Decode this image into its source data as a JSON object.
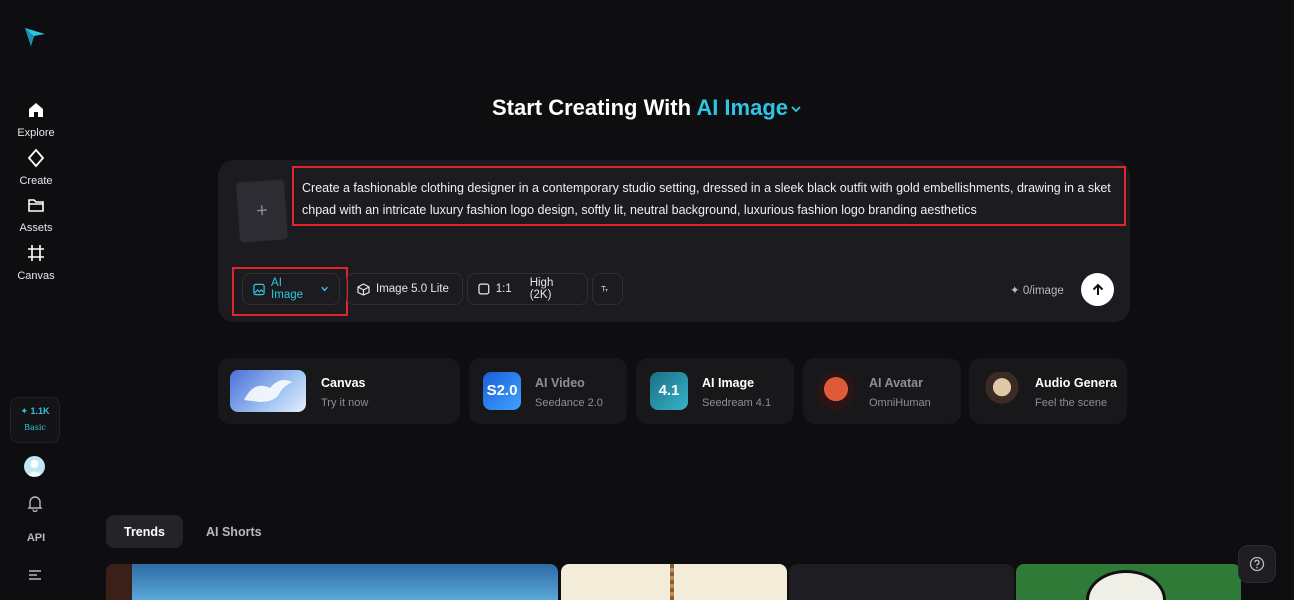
{
  "sidebar": {
    "items": [
      {
        "label": "Explore",
        "icon": "home-icon"
      },
      {
        "label": "Create",
        "icon": "diamond-icon"
      },
      {
        "label": "Assets",
        "icon": "folder-icon"
      },
      {
        "label": "Canvas",
        "icon": "grid-icon"
      }
    ],
    "credits": {
      "amount": "✦ 1.1K",
      "plan": "Basic"
    },
    "api_label": "API"
  },
  "heading": {
    "prefix": "Start Creating With ",
    "accent": "AI Image"
  },
  "prompt": {
    "text": "Create a fashionable clothing designer in a contemporary studio setting, dressed in a sleek black outfit with gold embellishments, drawing in a sketchpad with an intricate luxury fashion logo design, softly lit, neutral background, luxurious fashion logo branding aesthetics",
    "upload_symbol": "+"
  },
  "toolbar": {
    "mode": "AI Image",
    "model": "Image 5.0 Lite",
    "ratio": "1:1",
    "quality": "High (2K)",
    "cost": "✦ 0/image"
  },
  "cards": [
    {
      "title": "Canvas",
      "subtitle": "Try it now"
    },
    {
      "title": "AI Video",
      "subtitle": "Seedance 2.0",
      "badge": "S2.0"
    },
    {
      "title": "AI Image",
      "subtitle": "Seedream 4.1",
      "badge": "4.1"
    },
    {
      "title": "AI Avatar",
      "subtitle": "OmniHuman"
    },
    {
      "title": "Audio Genera",
      "subtitle": "Feel the scene"
    }
  ],
  "tabs": [
    {
      "label": "Trends"
    },
    {
      "label": "AI Shorts"
    }
  ],
  "colors": {
    "accent": "#2ec5e0",
    "highlight": "#e3232e",
    "background": "#0e0e10"
  }
}
